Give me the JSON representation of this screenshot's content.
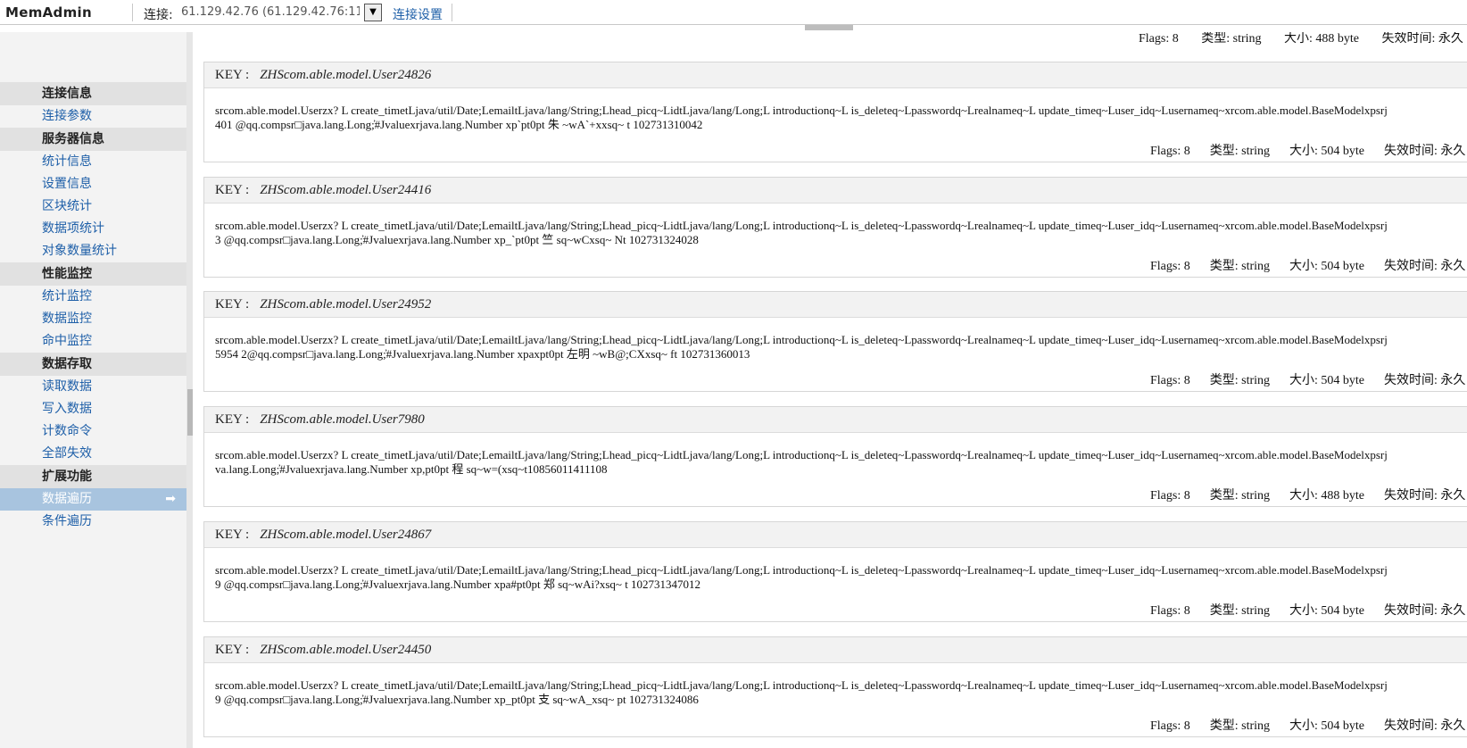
{
  "app": {
    "title": "MemAdmin"
  },
  "connection": {
    "label": "连接:",
    "value": "61.129.42.76 (61.129.42.76:11",
    "settings_label": "连接设置"
  },
  "sidebar": {
    "groups": [
      {
        "title": "连接信息",
        "items": [
          {
            "label": "连接参数"
          }
        ]
      },
      {
        "title": "服务器信息",
        "items": [
          {
            "label": "统计信息"
          },
          {
            "label": "设置信息"
          },
          {
            "label": "区块统计"
          },
          {
            "label": "数据项统计"
          },
          {
            "label": "对象数量统计"
          }
        ]
      },
      {
        "title": "性能监控",
        "items": [
          {
            "label": "统计监控"
          },
          {
            "label": "数据监控"
          },
          {
            "label": "命中监控"
          }
        ]
      },
      {
        "title": "数据存取",
        "items": [
          {
            "label": "读取数据"
          },
          {
            "label": "写入数据"
          },
          {
            "label": "计数命令"
          },
          {
            "label": "全部失效"
          }
        ]
      },
      {
        "title": "扩展功能",
        "items": [
          {
            "label": "数据遍历",
            "active": true
          },
          {
            "label": "条件遍历"
          }
        ]
      }
    ],
    "active_arrow": "➡"
  },
  "meta_labels": {
    "flags": "Flags:",
    "type": "类型:",
    "size": "大小:",
    "expire": "失效时间:"
  },
  "partial_record": {
    "flags": "8",
    "type": "string",
    "size": "488 byte",
    "expire": "永久"
  },
  "records": [
    {
      "key_label": "KEY :",
      "key": "ZHScom.able.model.User24826",
      "line1": "srcom.able.model.Userzx?  L create_timetLjava/util/Date;LemailtLjava/lang/String;Lhead_picq~LidtLjava/lang/Long;L introductionq~L is_deleteq~Lpasswordq~Lrealnameq~L update_timeq~Luser_idq~Lusernameq~xrcom.able.model.BaseModelxpsrj",
      "line2": "401       @qq.compsr□java.lang.Long;̓#Jvaluexrjava.lang.Number xp`pt0pt 朱       ~wA`+xxsq~ t 102731310042",
      "flags": "8",
      "type": "string",
      "size": "504 byte",
      "expire": "永久"
    },
    {
      "key_label": "KEY :",
      "key": "ZHScom.able.model.User24416",
      "line1": "srcom.able.model.Userzx?  L create_timetLjava/util/Date;LemailtLjava/lang/String;Lhead_picq~LidtLjava/lang/Long;L introductionq~L is_deleteq~Lpasswordq~Lrealnameq~L update_timeq~Luser_idq~Lusernameq~xrcom.able.model.BaseModelxpsrj",
      "line2": "3     @qq.compsr□java.lang.Long;̓#Jvaluexrjava.lang.Number xp_`pt0pt 竺      sq~wCxsq~ Nt 102731324028",
      "flags": "8",
      "type": "string",
      "size": "504 byte",
      "expire": "永久"
    },
    {
      "key_label": "KEY :",
      "key": "ZHScom.able.model.User24952",
      "line1": "srcom.able.model.Userzx?  L create_timetLjava/util/Date;LemailtLjava/lang/String;Lhead_picq~LidtLjava/lang/Long;L introductionq~L is_deleteq~Lpasswordq~Lrealnameq~L update_timeq~Luser_idq~Lusernameq~xrcom.able.model.BaseModelxpsrj",
      "line2": "5954      2@qq.compsr□java.lang.Long;̓#Jvaluexrjava.lang.Number xpaxpt0pt 左明      ~wB@;CXxsq~ ft 102731360013",
      "flags": "8",
      "type": "string",
      "size": "504 byte",
      "expire": "永久"
    },
    {
      "key_label": "KEY :",
      "key": "ZHScom.able.model.User7980",
      "line1": "srcom.able.model.Userzx?  L create_timetLjava/util/Date;LemailtLjava/lang/String;Lhead_picq~LidtLjava/lang/Long;L introductionq~L is_deleteq~Lpasswordq~Lrealnameq~L update_timeq~Luser_idq~Lusernameq~xrcom.able.model.BaseModelxpsrj",
      "line2": "va.lang.Long;̓#Jvaluexrjava.lang.Number xp,pt0pt 程      sq~w=(xsq~t10856011411108",
      "flags": "8",
      "type": "string",
      "size": "488 byte",
      "expire": "永久"
    },
    {
      "key_label": "KEY :",
      "key": "ZHScom.able.model.User24867",
      "line1": "srcom.able.model.Userzx?  L create_timetLjava/util/Date;LemailtLjava/lang/String;Lhead_picq~LidtLjava/lang/Long;L introductionq~L is_deleteq~Lpasswordq~Lrealnameq~L update_timeq~Luser_idq~Lusernameq~xrcom.able.model.BaseModelxpsrj",
      "line2": "9      @qq.compsr□java.lang.Long;̓#Jvaluexrjava.lang.Number xpa#pt0pt 郑      sq~wAi?xsq~ t 102731347012",
      "flags": "8",
      "type": "string",
      "size": "504 byte",
      "expire": "永久"
    },
    {
      "key_label": "KEY :",
      "key": "ZHScom.able.model.User24450",
      "line1": "srcom.able.model.Userzx?  L create_timetLjava/util/Date;LemailtLjava/lang/String;Lhead_picq~LidtLjava/lang/Long;L introductionq~L is_deleteq~Lpasswordq~Lrealnameq~L update_timeq~Luser_idq~Lusernameq~xrcom.able.model.BaseModelxpsrj",
      "line2": "9      @qq.compsr□java.lang.Long;̓#Jvaluexrjava.lang.Number xp_pt0pt 支      sq~wA_xsq~ pt 102731324086",
      "flags": "8",
      "type": "string",
      "size": "504 byte",
      "expire": "永久"
    }
  ]
}
